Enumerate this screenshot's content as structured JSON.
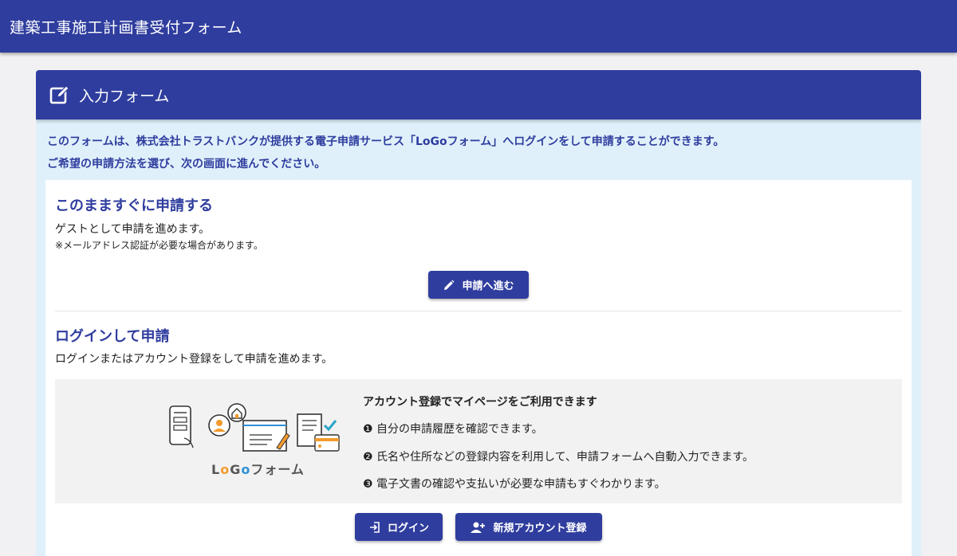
{
  "appbar": {
    "title": "建築工事施工計画書受付フォーム"
  },
  "card": {
    "title": "入力フォーム",
    "header_icon": "edit-square-icon"
  },
  "intro": {
    "line1": "このフォームは、株式会社トラストバンクが提供する電子申請サービス「LoGoフォーム」へログインをして申請することができます。",
    "line2": "ご希望の申請方法を選び、次の画面に進んでください。"
  },
  "guest": {
    "title": "このまますぐに申請する",
    "text": "ゲストとして申請を進めます。",
    "note": "※メールアドレス認証が必要な場合があります。",
    "button_label": "申請へ進む",
    "button_icon": "pencil-icon"
  },
  "login": {
    "title": "ログインして申請",
    "text": "ログインまたはアカウント登録をして申請を進めます。",
    "info_title": "アカウント登録でマイページをご利用できます",
    "items": [
      "❶ 自分の申請履歴を確認できます。",
      "❷ 氏名や住所などの登録内容を利用して、申請フォームへ自動入力できます。",
      "❸ 電子文書の確認や支払いが必要な申請もすぐわかります。"
    ],
    "logo": {
      "part1": "L",
      "part2": "o",
      "part3": "G",
      "part4": "o",
      "part5": "フォーム"
    },
    "login_button": "ログイン",
    "login_icon": "login-icon",
    "register_button": "新規アカウント登録",
    "register_icon": "person-add-icon"
  },
  "colors": {
    "primary": "#2f3d9e",
    "intro_bg": "#dff0fb",
    "info_bg": "#f2f2f2",
    "check": "#2aa6c9"
  }
}
